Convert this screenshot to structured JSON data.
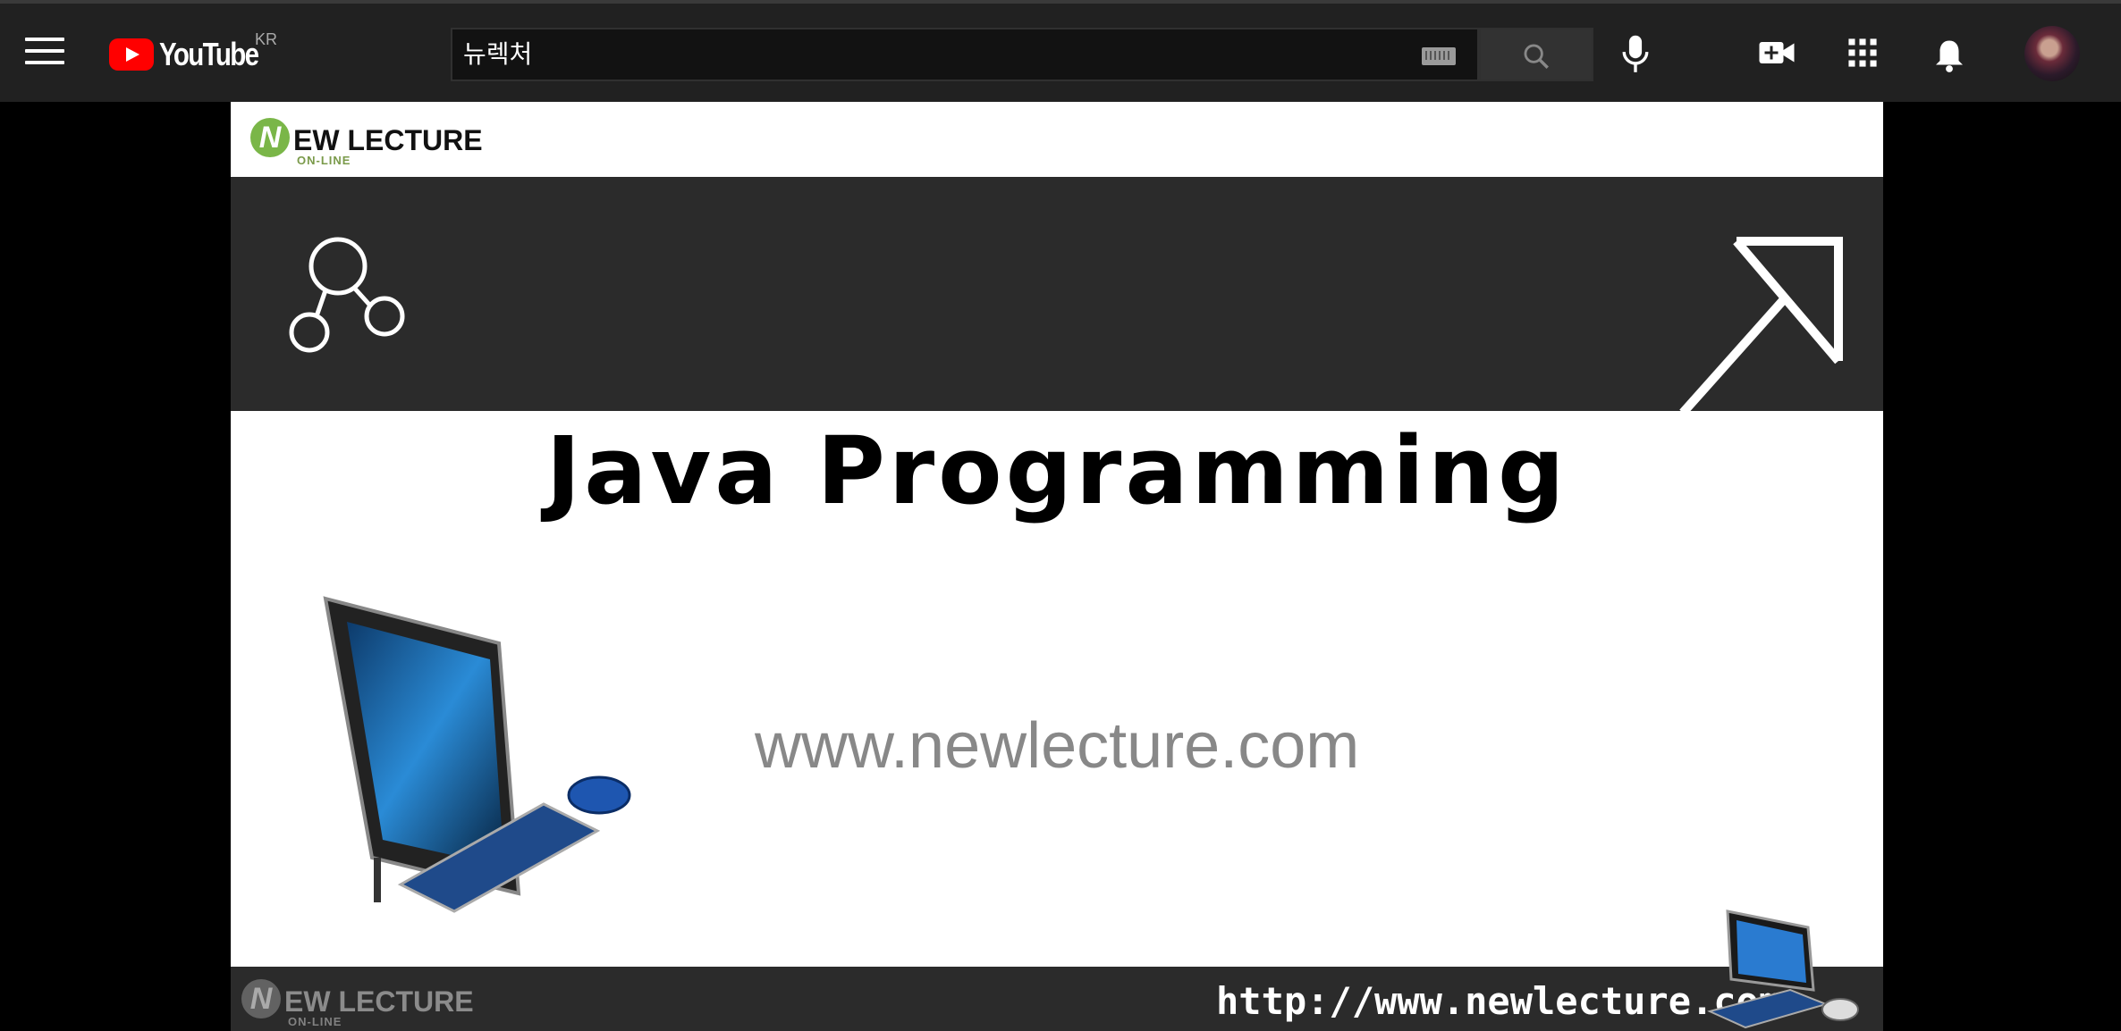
{
  "header": {
    "logo_text": "YouTube",
    "region": "KR",
    "search_value": "뉴렉처",
    "icons": [
      "menu-icon",
      "keyboard-icon",
      "search-icon",
      "mic-icon",
      "create-video-icon",
      "apps-icon",
      "notifications-icon"
    ]
  },
  "video": {
    "brand_top": "EW LECTURE",
    "brand_top_sub": "ON-LINE",
    "brand_n": "N",
    "title": "Java Programming",
    "site_url": "www.newlecture.com",
    "brand_bottom": "EW LECTURE",
    "brand_bottom_sub": "ON-LINE",
    "footer_url": "http://www.newlecture.com"
  },
  "colors": {
    "topbar": "#212121",
    "youtube_red": "#ff0000",
    "brand_green": "#7ab648",
    "band": "#2b2b2b"
  }
}
